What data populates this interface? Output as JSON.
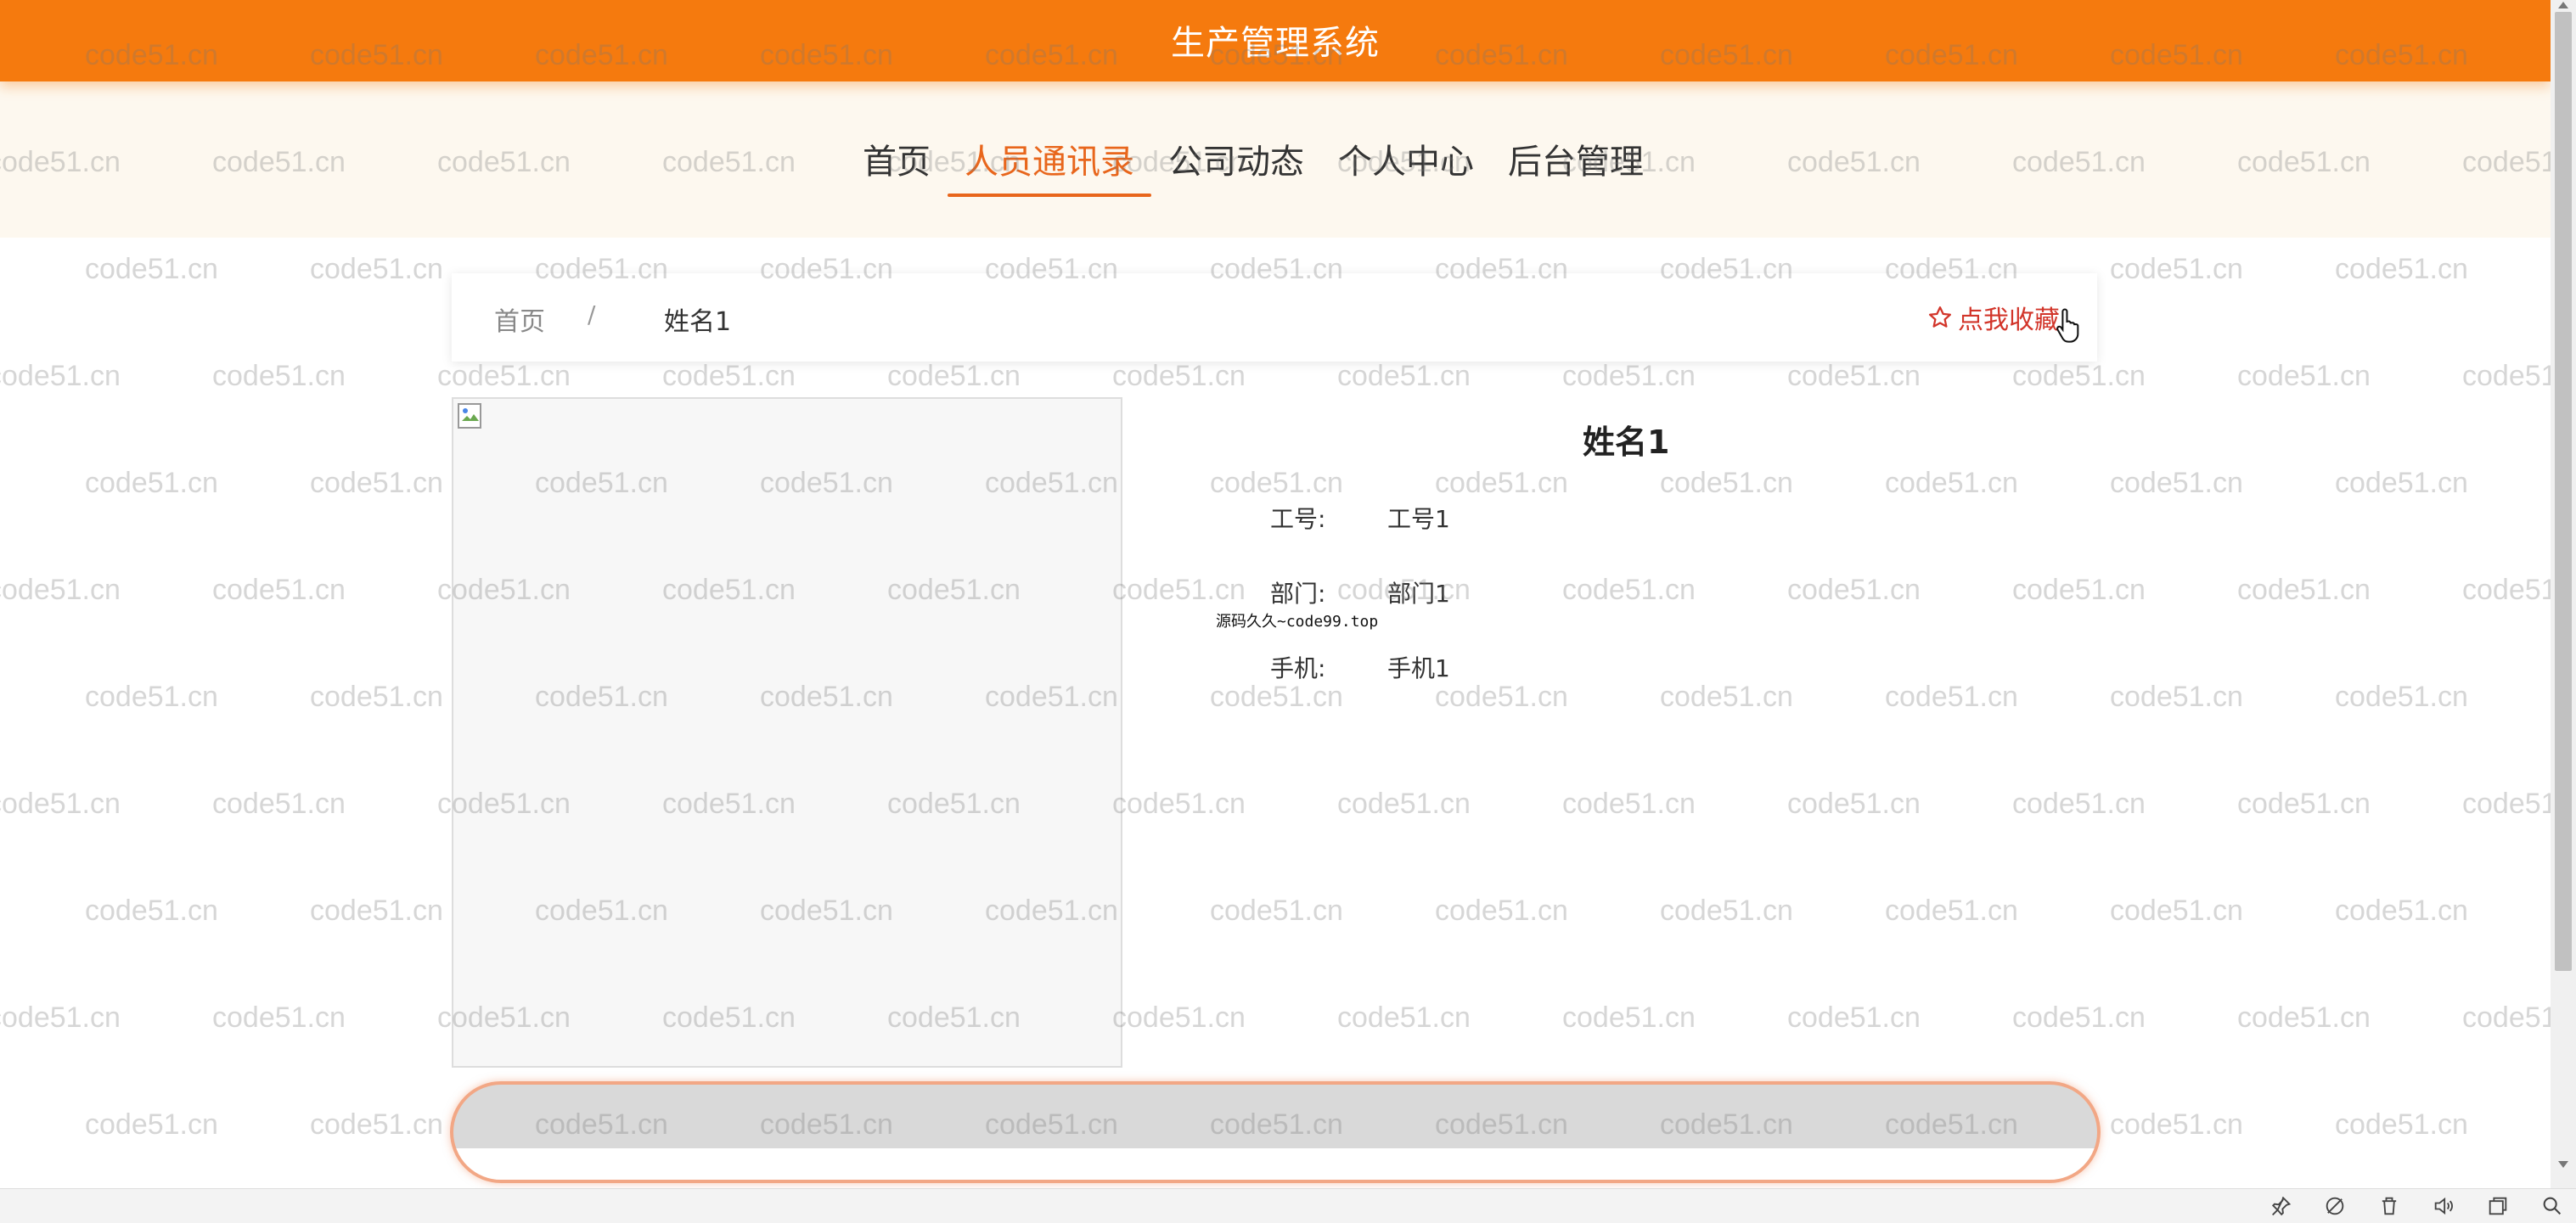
{
  "header": {
    "title": "生产管理系统"
  },
  "nav": {
    "items": [
      {
        "label": "首页",
        "active": false
      },
      {
        "label": "人员通讯录",
        "active": true
      },
      {
        "label": "公司动态",
        "active": false
      },
      {
        "label": "个人中心",
        "active": false
      },
      {
        "label": "后台管理",
        "active": false
      }
    ]
  },
  "breadcrumb": {
    "home": "首页",
    "separator": "/",
    "current": "姓名1"
  },
  "favorite": {
    "label": "点我收藏",
    "icon": "star-outline-icon"
  },
  "detail": {
    "name": "姓名1",
    "fields": [
      {
        "label": "工号:",
        "value": "工号1"
      },
      {
        "label": "部门:",
        "value": "部门1"
      },
      {
        "label": "手机:",
        "value": "手机1"
      }
    ],
    "source_note": "源码久久~code99.top"
  },
  "watermark": "code51.cn",
  "colors": {
    "header_bg": "#f57a0e",
    "nav_bg": "#fdf8ef",
    "nav_active": "#e8661c",
    "favorite": "#d2352a"
  }
}
